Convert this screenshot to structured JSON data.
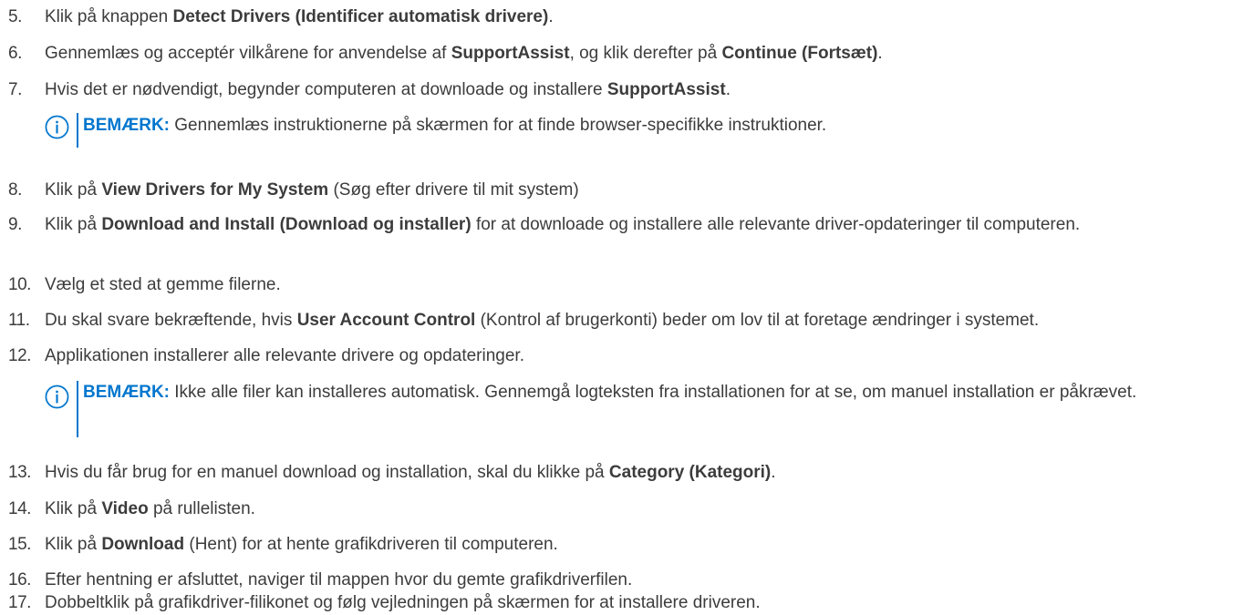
{
  "colors": {
    "accent": "#0076ce",
    "text": "#3c3c3c"
  },
  "icons": {
    "note": "info-circle-icon"
  },
  "steps": [
    {
      "n": "5.",
      "pre": "Klik på knappen ",
      "b": "Detect Drivers (Identificer automatisk drivere)",
      "post": "."
    },
    {
      "n": "6.",
      "pre": "Gennemlæs og acceptér vilkårene for anvendelse af ",
      "b": "SupportAssist",
      "mid": ", og klik derefter på ",
      "b2": "Continue (Fortsæt)",
      "post": "."
    },
    {
      "n": "7.",
      "pre": "Hvis det er nødvendigt, begynder computeren at downloade og installere ",
      "b": "SupportAssist",
      "post": "."
    },
    {
      "n": "8.",
      "pre": "Klik på ",
      "b": "View Drivers for My System",
      "post": " (Søg efter drivere til mit system)"
    },
    {
      "n": "9.",
      "pre": "Klik på ",
      "b": "Download and Install (Download og installer)",
      "post": " for at downloade og installere alle relevante driver-opdateringer til computeren."
    },
    {
      "n": "10.",
      "text": "Vælg et sted at gemme filerne."
    },
    {
      "n": "11.",
      "pre": "Du skal svare bekræftende, hvis ",
      "b": "User Account Control",
      "post": " (Kontrol af brugerkonti) beder om lov til at foretage ændringer i systemet."
    },
    {
      "n": "12.",
      "text": "Applikationen installerer alle relevante drivere og opdateringer."
    },
    {
      "n": "13.",
      "pre": "Hvis du får brug for en manuel download og installation, skal du klikke på ",
      "b": "Category (Kategori)",
      "post": "."
    },
    {
      "n": "14.",
      "pre": "Klik på ",
      "b": "Video",
      "post": " på rullelisten."
    },
    {
      "n": "15.",
      "pre": "Klik på ",
      "b": "Download",
      "post": " (Hent) for at hente grafikdriveren til computeren."
    },
    {
      "n": "16.",
      "text": "Efter hentning er afsluttet, naviger til mappen hvor du gemte grafikdriverfilen."
    },
    {
      "n": "17.",
      "text": "Dobbeltklik på grafikdriver-filikonet og følg vejledningen på skærmen for at installere driveren."
    }
  ],
  "notes": [
    {
      "label": "BEMÆRK:",
      "text": " Gennemlæs instruktionerne på skærmen for at finde browser-specifikke instruktioner."
    },
    {
      "label": "BEMÆRK:",
      "text": " Ikke alle filer kan installeres automatisk. Gennemgå logteksten fra installationen for at se, om manuel installation er påkrævet."
    }
  ]
}
